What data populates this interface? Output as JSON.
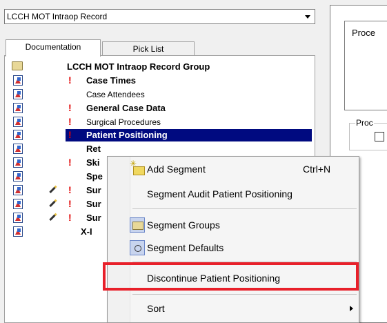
{
  "combo": {
    "value": "LCCH MOT Intraop Record"
  },
  "tabs": [
    {
      "label": "Documentation"
    },
    {
      "label": "Pick List"
    }
  ],
  "tree": {
    "root": "LCCH MOT Intraop Record Group",
    "items": [
      {
        "label": "Case Times",
        "bold": true,
        "required": true,
        "edited": false
      },
      {
        "label": "Case Attendees",
        "bold": false,
        "required": false,
        "edited": false
      },
      {
        "label": "General Case Data",
        "bold": true,
        "required": true,
        "edited": false
      },
      {
        "label": "Surgical Procedures",
        "bold": false,
        "required": true,
        "edited": false
      },
      {
        "label": "Patient Positioning",
        "bold": true,
        "required": true,
        "edited": false,
        "selected": true
      },
      {
        "label": "Ret",
        "bold": true,
        "required": false,
        "edited": false
      },
      {
        "label": "Ski",
        "bold": true,
        "required": true,
        "edited": false
      },
      {
        "label": "Spe",
        "bold": true,
        "required": false,
        "edited": false
      },
      {
        "label": "Sur",
        "bold": true,
        "required": true,
        "edited": true
      },
      {
        "label": "Sur",
        "bold": true,
        "required": true,
        "edited": true
      },
      {
        "label": "Sur",
        "bold": true,
        "required": true,
        "edited": true
      },
      {
        "label": "X-I",
        "bold": true,
        "required": false,
        "edited": false
      }
    ]
  },
  "right": {
    "proc_label": "Proce",
    "group_label": "Proc"
  },
  "context_menu": {
    "add_segment": "Add Segment",
    "add_segment_shortcut": "Ctrl+N",
    "segment_audit": "Segment Audit Patient Positioning",
    "segment_groups": "Segment Groups",
    "segment_defaults": "Segment Defaults",
    "discontinue": "Discontinue Patient Positioning",
    "sort": "Sort"
  },
  "colors": {
    "selection": "#000a80",
    "highlight": "#e8202a",
    "required": "#e00000"
  }
}
